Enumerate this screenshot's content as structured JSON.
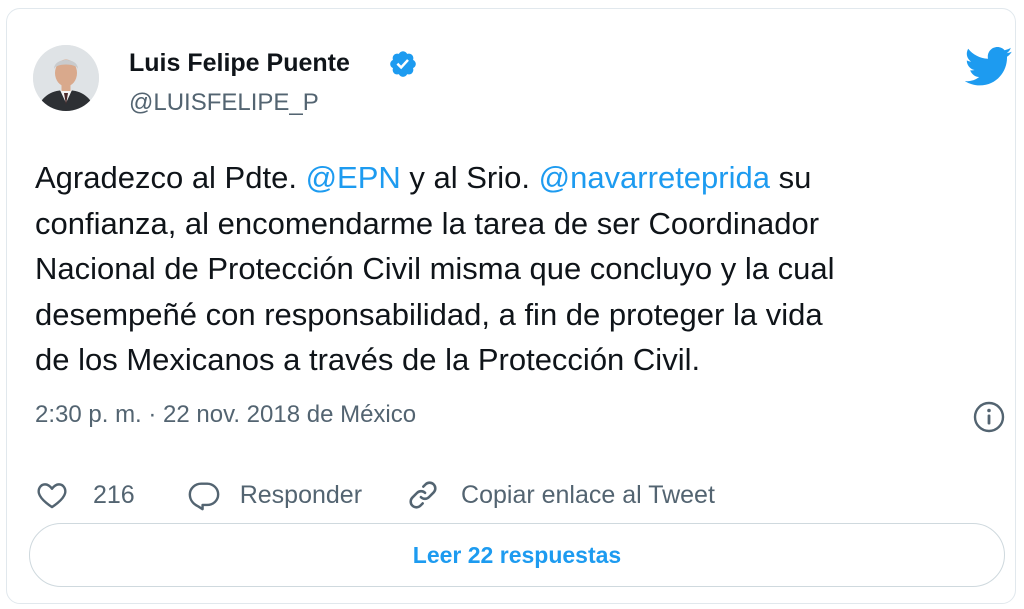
{
  "author": {
    "name": "Luis Felipe Puente",
    "handle": "@LUISFELIPE_P",
    "verified": true,
    "avatar_icon": "profile-photo"
  },
  "tweet": {
    "segments": [
      {
        "text": "Agradezco al Pdte. ",
        "type": "text"
      },
      {
        "text": "@EPN",
        "type": "mention"
      },
      {
        "text": " y al Srio. ",
        "type": "text"
      },
      {
        "text": "@navarreteprida",
        "type": "mention"
      },
      {
        "text": " su\nconfianza, al encomendarme la tarea de ser Coordinador\nNacional de Protección Civil misma que concluyo y la cual\ndesempeñé con responsabilidad, a fin de proteger la vida\nde los Mexicanos a través de la Protección Civil.",
        "type": "text"
      }
    ],
    "timestamp": "2:30 p. m. · 22 nov. 2018 de México"
  },
  "actions": {
    "likes_count": "216",
    "reply_label": "Responder",
    "copy_link_label": "Copiar enlace al Tweet"
  },
  "read_replies_label": "Leer 22 respuestas",
  "icons": {
    "brand": "twitter-bird-icon",
    "verified": "verified-badge-icon",
    "info": "info-icon",
    "like": "heart-icon",
    "reply": "speech-bubble-icon",
    "link": "link-icon"
  },
  "colors": {
    "accent": "#1d9bf0",
    "text": "#0f1419",
    "secondary": "#536471",
    "border": "#cfd9de"
  }
}
